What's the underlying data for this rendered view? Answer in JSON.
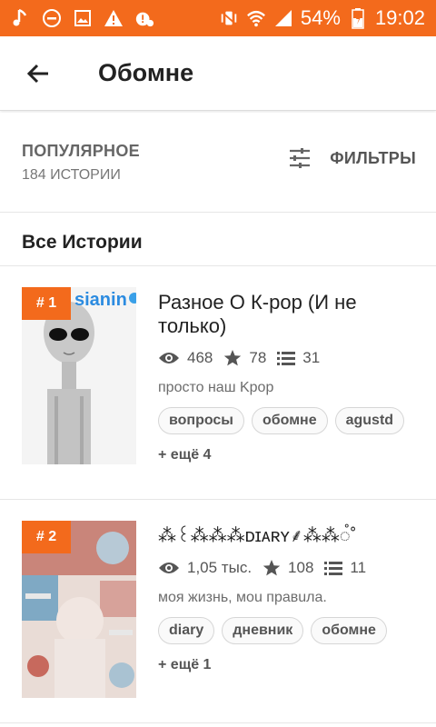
{
  "status_bar": {
    "battery": "54%",
    "time": "19:02"
  },
  "appbar": {
    "title": "Обомне"
  },
  "section": {
    "label": "ПОПУЛЯРНОЕ",
    "count": "184 ИСТОРИИ",
    "filter_label": "ФИЛЬТРЫ"
  },
  "list_header": "Все Истории",
  "stories": [
    {
      "rank": "# 1",
      "cover_text": "sianin",
      "title": "Разное О К-рор (И не только)",
      "reads": "468",
      "votes": "78",
      "parts": "31",
      "description": "просто наш   Kpop",
      "tags": [
        "вопросы",
        "обомне",
        "agustd"
      ],
      "more": "+ ещё 4"
    },
    {
      "rank": "# 2",
      "title": "⁂꒰⁂⁂⁂ᴅɪᴀʀʏ⸙⁂⁂◌̊˚",
      "reads": "1,05 тыс.",
      "votes": "108",
      "parts": "11",
      "description": "моя жизнь, моu правuла.",
      "tags": [
        "diary",
        "дневник",
        "обомне"
      ],
      "more": "+ ещё 1"
    }
  ],
  "colors": {
    "accent": "#f36a1c",
    "text": "#222222",
    "muted": "#666666"
  },
  "icons": [
    "music-note-icon",
    "do-not-disturb-icon",
    "image-icon",
    "warning-icon",
    "alert-cloud-icon",
    "vibrate-icon",
    "wifi-icon",
    "signal-icon",
    "battery-icon",
    "back-arrow-icon",
    "filter-icon",
    "eye-icon",
    "star-icon",
    "list-icon"
  ]
}
